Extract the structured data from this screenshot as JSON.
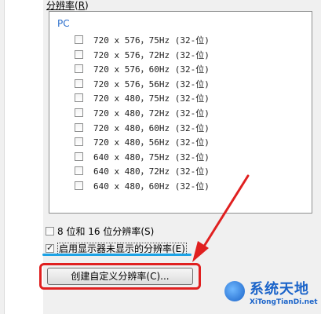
{
  "group_label": "分辨率",
  "group_label_key": "R",
  "list": {
    "header": "PC",
    "items": [
      {
        "text": "720 x 576，75Hz (32-位)"
      },
      {
        "text": "720 x 576，72Hz (32-位)"
      },
      {
        "text": "720 x 576，60Hz (32-位)"
      },
      {
        "text": "720 x 576，56Hz (32-位)"
      },
      {
        "text": "720 x 480，75Hz (32-位)"
      },
      {
        "text": "720 x 480，72Hz (32-位)"
      },
      {
        "text": "720 x 480，60Hz (32-位)"
      },
      {
        "text": "720 x 480，56Hz (32-位)"
      },
      {
        "text": "640 x 480，75Hz (32-位)"
      },
      {
        "text": "640 x 480，72Hz (32-位)"
      },
      {
        "text": "640 x 480，60Hz (32-位)"
      }
    ]
  },
  "options": {
    "low_color_label": "8 位和 16 位分辨率(S)",
    "show_hidden_label": "启用显示器未显示的分辨率(E)",
    "show_hidden_checked": true
  },
  "buttons": {
    "create_custom_label": "创建自定义分辨率(C)..."
  },
  "watermark": {
    "title": "系统天地",
    "subtitle": "XiTongTianDi.net"
  },
  "colors": {
    "annotation_red": "#e02020",
    "annotation_blue": "#1da3e6",
    "header_blue": "#2d6fcc"
  }
}
